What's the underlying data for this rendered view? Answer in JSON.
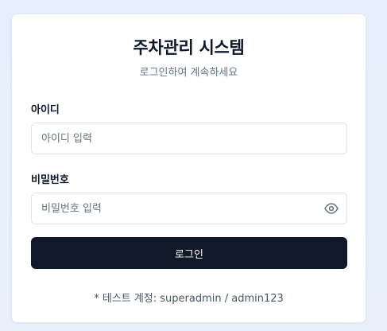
{
  "header": {
    "title": "주차관리 시스템",
    "subtitle": "로그인하여 계속하세요"
  },
  "form": {
    "username": {
      "label": "아이디",
      "placeholder": "아이디 입력",
      "value": ""
    },
    "password": {
      "label": "비밀번호",
      "placeholder": "비밀번호 입력",
      "value": "",
      "toggle_icon": "eye-icon"
    },
    "submit_label": "로그인"
  },
  "footer": {
    "test_account": "* 테스트 계정: superadmin / admin123"
  },
  "colors": {
    "accent_button": "#111827",
    "title_text": "#0f172a",
    "muted_text": "#64748b",
    "background": "#e6effb"
  }
}
